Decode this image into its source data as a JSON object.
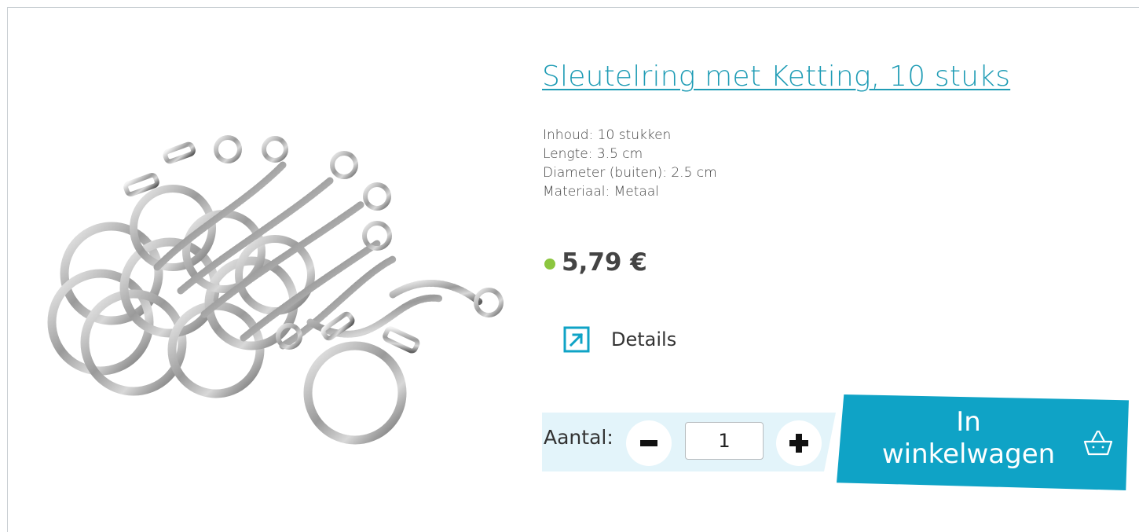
{
  "product": {
    "title": "Sleutelring met Ketting, 10 stuks",
    "image_icon": "keyring-chain-photo",
    "specs": [
      "Inhoud: 10 stukken",
      "Lengte: 3.5 cm",
      "Diameter (buiten): 2.5 cm",
      "Materiaal: Metaal"
    ],
    "price": "5,79 €",
    "stock_color": "#8cc63f",
    "details_label": "Details",
    "details_icon": "external-arrow-icon"
  },
  "quantity": {
    "label": "Aantal:",
    "value": "1",
    "minus_icon": "minus-icon",
    "plus_icon": "plus-icon"
  },
  "cart": {
    "line1": "In",
    "line2": "winkelwagen",
    "icon": "basket-icon",
    "color": "#0fa3c6"
  },
  "colors": {
    "accent": "#1f9cb5",
    "qty_background": "#e3f4fa"
  }
}
